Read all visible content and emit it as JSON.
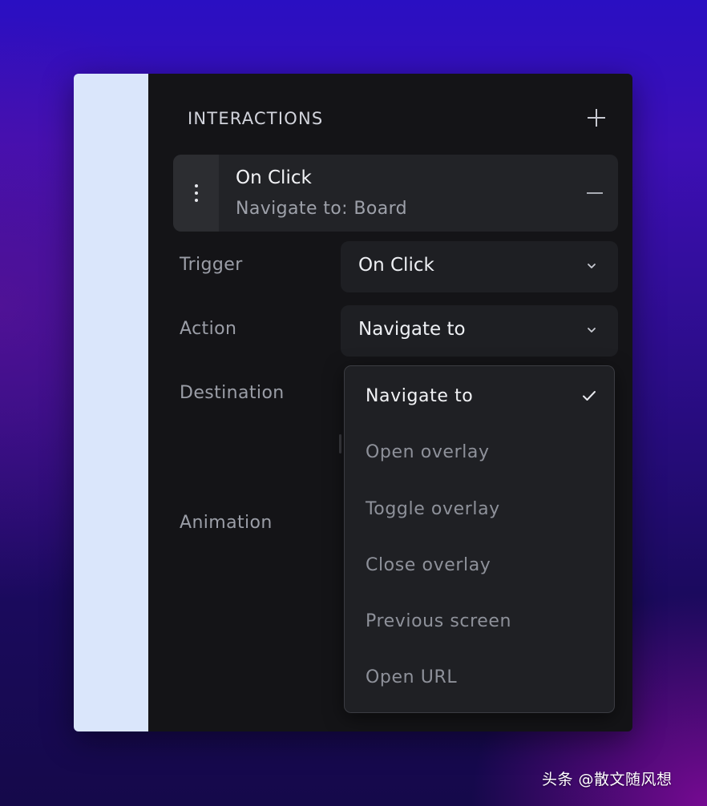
{
  "panel": {
    "section_title": "INTERACTIONS"
  },
  "interaction": {
    "title": "On Click",
    "subtitle": "Navigate to: Board"
  },
  "fields": {
    "trigger": {
      "label": "Trigger",
      "value": "On Click"
    },
    "action": {
      "label": "Action",
      "value": "Navigate to"
    },
    "destination": {
      "label": "Destination"
    },
    "animation": {
      "label": "Animation"
    }
  },
  "dropdown": {
    "options": [
      {
        "label": "Navigate to",
        "selected": true
      },
      {
        "label": "Open overlay",
        "selected": false
      },
      {
        "label": "Toggle overlay",
        "selected": false
      },
      {
        "label": "Close overlay",
        "selected": false
      },
      {
        "label": "Previous screen",
        "selected": false
      },
      {
        "label": "Open URL",
        "selected": false
      }
    ]
  },
  "icons": {
    "add": "plus-icon",
    "remove": "minus-icon",
    "drag": "vertical-dots-icon",
    "chevron": "chevron-down-icon",
    "check": "check-icon"
  },
  "watermark": "头条 @散文随风想",
  "colors": {
    "panel_background": "#141417",
    "canvas_strip": "#dae6fb",
    "card_background": "#222327",
    "text_primary": "#f2f3f6",
    "text_muted": "#8e919a"
  }
}
